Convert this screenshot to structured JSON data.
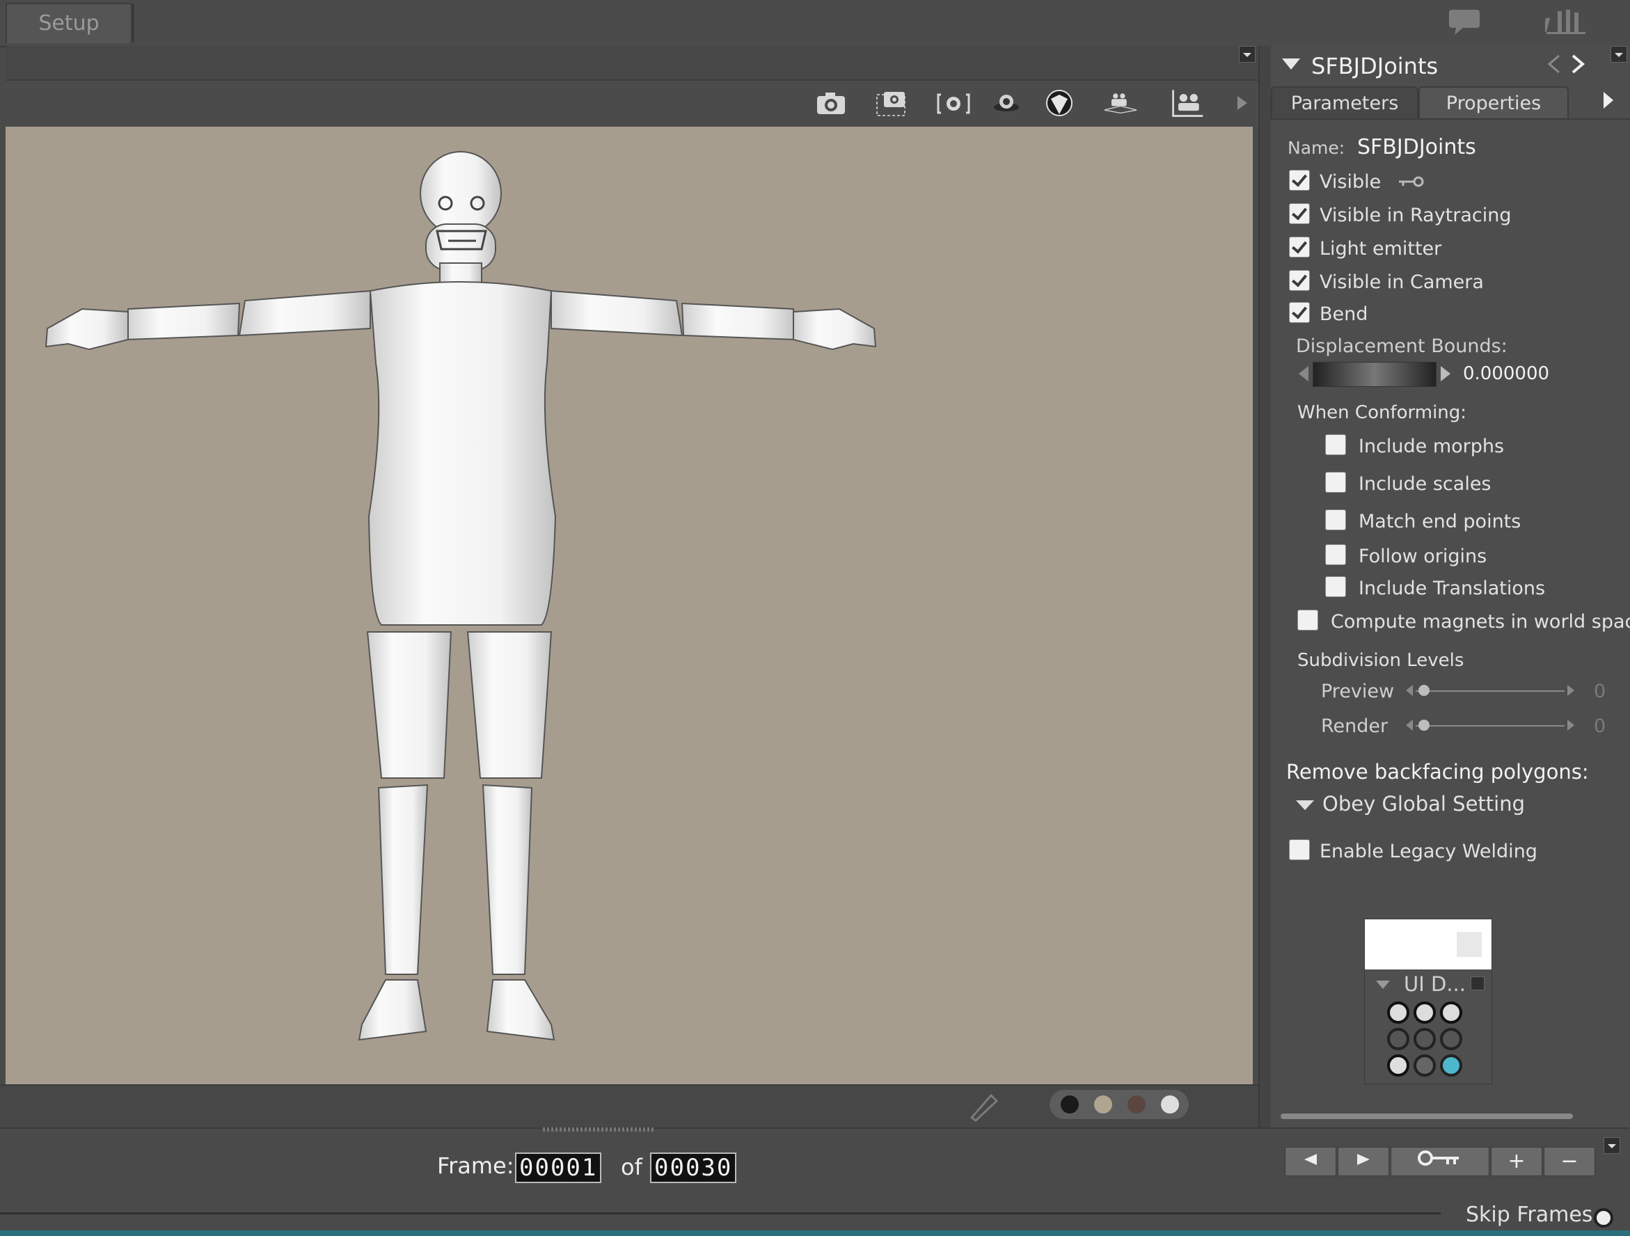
{
  "top_tab": {
    "label": "Setup"
  },
  "panel": {
    "title": "SFBJDJoints",
    "tabs": [
      "Parameters",
      "Properties"
    ],
    "active_tab": "Properties",
    "name_label": "Name:",
    "name_value": "SFBJDJoints",
    "checks": [
      {
        "label": "Visible",
        "checked": true
      },
      {
        "label": "Visible in Raytracing",
        "checked": true
      },
      {
        "label": "Light emitter",
        "checked": true
      },
      {
        "label": "Visible in Camera",
        "checked": true
      },
      {
        "label": "Bend",
        "checked": true
      }
    ],
    "displacement_label": "Displacement Bounds:",
    "displacement_value": "0.000000",
    "conforming_label": "When Conforming:",
    "conforming_checks": [
      {
        "label": "Include morphs",
        "checked": false
      },
      {
        "label": "Include scales",
        "checked": false
      },
      {
        "label": "Match end points",
        "checked": false
      },
      {
        "label": "Follow origins",
        "checked": false
      },
      {
        "label": "Include Translations",
        "checked": false
      }
    ],
    "magnets_label": "Compute magnets in world space",
    "subdivision_label": "Subdivision Levels",
    "preview_label": "Preview",
    "preview_value": "0",
    "render_label": "Render",
    "render_value": "0",
    "backfacing_label": "Remove backfacing polygons:",
    "backfacing_option": "Obey Global Setting",
    "legacy_label": "Enable Legacy Welding",
    "mini_panel_title": "UI D..."
  },
  "timeline": {
    "frame_label": "Frame:",
    "frame_value": "00001",
    "of_label": "of",
    "total_value": "00030",
    "skip_label": "Skip Frames"
  },
  "colors": {
    "viewport_bg": "#a79d8f",
    "ui_bg": "#4a4a4a",
    "figure": "#efefef"
  },
  "icons": [
    "camera-icon",
    "camera-select-icon",
    "camera-target-icon",
    "sphere-light-icon",
    "ball-icon",
    "group-camera-icon",
    "group-people-icon",
    "chat-icon",
    "library-icon",
    "pencil-icon",
    "key-icon"
  ]
}
